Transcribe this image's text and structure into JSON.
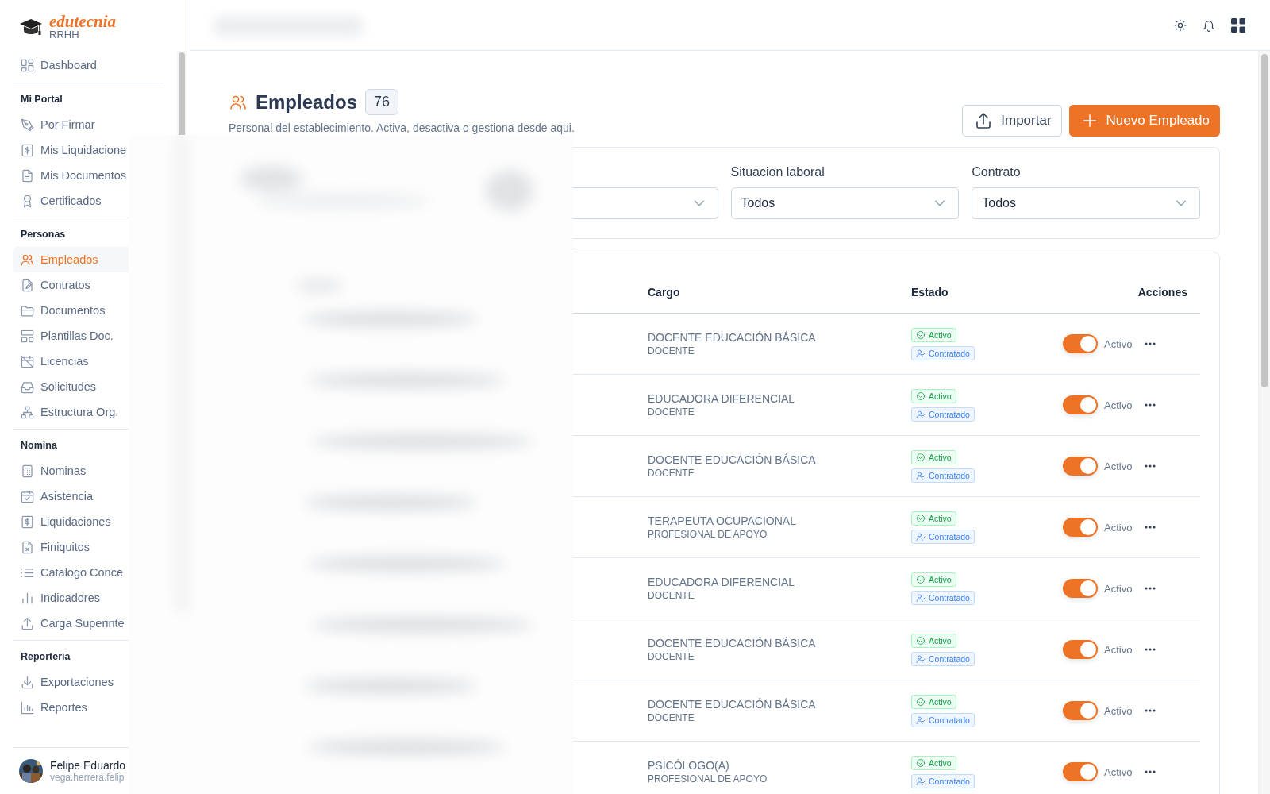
{
  "brand": {
    "name": "edutecnia",
    "subtitle": "RRHH"
  },
  "sidebar": {
    "sections": [
      {
        "items": [
          {
            "label": "Dashboard",
            "selected": false
          }
        ]
      },
      {
        "title": "Mi Portal",
        "items": [
          {
            "label": "Por Firmar",
            "selected": false
          },
          {
            "label": "Mis Liquidacione",
            "selected": false
          },
          {
            "label": "Mis Documentos",
            "selected": false
          },
          {
            "label": "Certificados",
            "selected": false
          }
        ]
      },
      {
        "title": "Personas",
        "items": [
          {
            "label": "Empleados",
            "selected": true
          },
          {
            "label": "Contratos",
            "selected": false
          },
          {
            "label": "Documentos",
            "selected": false
          },
          {
            "label": "Plantillas Doc.",
            "selected": false
          },
          {
            "label": "Licencias",
            "selected": false
          },
          {
            "label": "Solicitudes",
            "selected": false
          },
          {
            "label": "Estructura Org.",
            "selected": false
          }
        ]
      },
      {
        "title": "Nomina",
        "items": [
          {
            "label": "Nominas",
            "selected": false
          },
          {
            "label": "Asistencia",
            "selected": false
          },
          {
            "label": "Liquidaciones",
            "selected": false
          },
          {
            "label": "Finiquitos",
            "selected": false
          },
          {
            "label": "Catalogo Conce",
            "selected": false
          },
          {
            "label": "Indicadores",
            "selected": false
          },
          {
            "label": "Carga Superinte",
            "selected": false
          }
        ]
      },
      {
        "title": "Reportería",
        "items": [
          {
            "label": "Exportaciones",
            "selected": false
          },
          {
            "label": "Reportes",
            "selected": false
          }
        ]
      }
    ],
    "user": {
      "name": "Felipe Eduardo",
      "email": "vega.herrera.felip"
    }
  },
  "page": {
    "title": "Empleados",
    "count": "76",
    "subtitle": "Personal del establecimiento. Activa, desactiva o gestiona desde aqui.",
    "buttons": [
      {
        "label": "Importar",
        "kind": "secondary"
      },
      {
        "label": "Nuevo Empleado",
        "kind": "primary"
      }
    ]
  },
  "filters": [
    {
      "kind": "select"
    },
    {
      "kind": "select",
      "label": "Situacion laboral",
      "value": "Todos"
    },
    {
      "kind": "select",
      "label": "Contrato",
      "value": "Todos"
    }
  ],
  "table": {
    "columns": [
      "Cargo",
      "Estado",
      "Acciones"
    ],
    "rows": [
      {
        "cargo": "DOCENTE EDUCACIÓN BÁSICA",
        "tipo": "DOCENTE",
        "estado": "Activo",
        "contrato": "Contratado",
        "on": true,
        "toggle_label": "Activo"
      },
      {
        "cargo": "EDUCADORA DIFERENCIAL",
        "tipo": "DOCENTE",
        "estado": "Activo",
        "contrato": "Contratado",
        "on": true,
        "toggle_label": "Activo"
      },
      {
        "cargo": "DOCENTE EDUCACIÓN BÁSICA",
        "tipo": "DOCENTE",
        "estado": "Activo",
        "contrato": "Contratado",
        "on": true,
        "toggle_label": "Activo"
      },
      {
        "cargo": "TERAPEUTA OCUPACIONAL",
        "tipo": "PROFESIONAL DE APOYO",
        "estado": "Activo",
        "contrato": "Contratado",
        "on": true,
        "toggle_label": "Activo"
      },
      {
        "cargo": "EDUCADORA DIFERENCIAL",
        "tipo": "DOCENTE",
        "estado": "Activo",
        "contrato": "Contratado",
        "on": true,
        "toggle_label": "Activo"
      },
      {
        "cargo": "DOCENTE EDUCACIÓN BÁSICA",
        "tipo": "DOCENTE",
        "estado": "Activo",
        "contrato": "Contratado",
        "on": true,
        "toggle_label": "Activo"
      },
      {
        "cargo": "DOCENTE EDUCACIÓN BÁSICA",
        "tipo": "DOCENTE",
        "estado": "Activo",
        "contrato": "Contratado",
        "on": true,
        "toggle_label": "Activo"
      },
      {
        "cargo": "PSICÓLOGO(A)",
        "tipo": "PROFESIONAL DE APOYO",
        "estado": "Activo",
        "contrato": "Contratado",
        "on": true,
        "toggle_label": "Activo"
      }
    ]
  }
}
